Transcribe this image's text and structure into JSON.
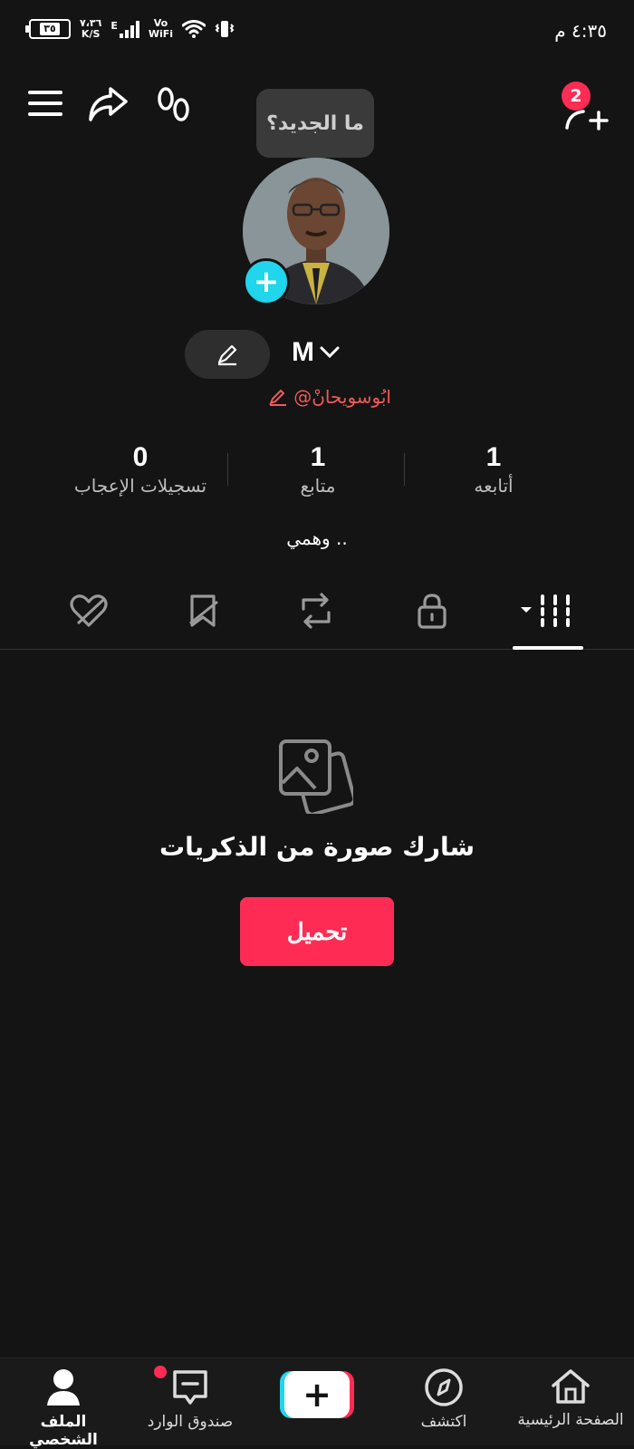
{
  "status_bar": {
    "time": "٤:٣٥ م",
    "battery": "٣٥",
    "net_speed": "٧،٣٦",
    "net_speed_unit": "K/S",
    "network_type": "E",
    "vowifi_top": "Vo",
    "vowifi_bottom": "WiFi"
  },
  "header": {
    "tooltip": "ما الجديد؟",
    "add_friends_badge": "2"
  },
  "profile": {
    "display_name": "M",
    "username": "@ابُوسويحانْ",
    "bio": "وهمي .."
  },
  "stats": [
    {
      "value": "1",
      "label": "أتابعه"
    },
    {
      "value": "1",
      "label": "متابع"
    },
    {
      "value": "0",
      "label": "تسجيلات الإعجاب"
    }
  ],
  "empty_state": {
    "title": "شارك صورة من الذكريات",
    "button": "تحميل"
  },
  "bottom_nav": {
    "home": "الصفحة الرئيسية",
    "discover": "اكتشف",
    "inbox": "صندوق الوارد",
    "profile": "الملف الشخصي"
  },
  "colors": {
    "accent": "#fe2c55",
    "cyan": "#20d5ec",
    "background": "#141414"
  },
  "icons": [
    "menu-icon",
    "share-icon",
    "footprints-icon",
    "add-friend-icon",
    "edit-icon",
    "chevron-down-icon",
    "grid-icon",
    "lock-icon",
    "repost-icon",
    "bookmark-icon",
    "liked-icon",
    "photo-icon",
    "home-icon",
    "compass-icon",
    "inbox-icon",
    "profile-icon"
  ]
}
